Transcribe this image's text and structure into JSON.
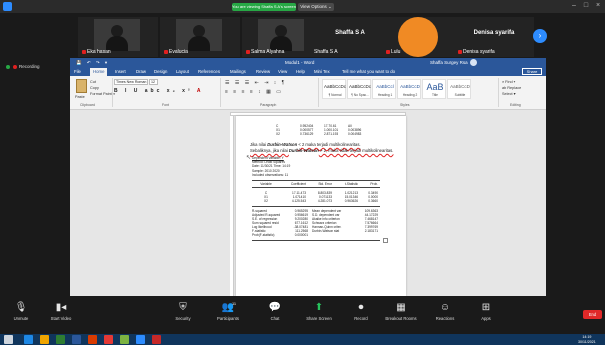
{
  "titlebar": {
    "share_banner": "You are viewing Shaffa S A's screen",
    "view_options": "View Options ⌄"
  },
  "participants": [
    {
      "name": "Eka hasan",
      "label": ""
    },
    {
      "name": "Evalucia",
      "label": ""
    },
    {
      "name": "Salma Alyahna",
      "label": ""
    },
    {
      "name": "Shaffa S A",
      "label": "Shaffa S A"
    },
    {
      "name": "Lulu",
      "label": ""
    },
    {
      "name": "Denisa syarifa",
      "label": "Denisa syarifa"
    }
  ],
  "recording": "Recording",
  "word": {
    "doc_title": "Modul1 - Word",
    "user": "Shaffa Surgey Rsa",
    "quick_access": "💾 ↶ ↷ ▾",
    "tabs": [
      "File",
      "Home",
      "Insert",
      "Draw",
      "Design",
      "Layout",
      "References",
      "Mailings",
      "Review",
      "View",
      "Help",
      "Mini Tex",
      "Tell me what you want to do"
    ],
    "share": "Share",
    "ribbon": {
      "paste": "Paste",
      "cut": "Cut",
      "copy": "Copy",
      "format_painter": "Format Painter",
      "clipboard": "Clipboard",
      "font_name": "Times New Roman",
      "font_size": "12",
      "format_buttons": "B I U abc x₂ x²",
      "font_color_a": "A",
      "font": "Font",
      "paragraph": "Paragraph",
      "styles": [
        {
          "sample": "AaBbCcDc",
          "name": "¶ Normal"
        },
        {
          "sample": "AaBbCcDc",
          "name": "¶ No Spac..."
        },
        {
          "sample": "AaBbCcl",
          "name": "Heading 1"
        },
        {
          "sample": "AaBbCcD",
          "name": "Heading 2"
        },
        {
          "sample": "AaB",
          "name": "Title"
        },
        {
          "sample": "AaBbCcD",
          "name": "Subtitle"
        }
      ],
      "styles_label": "Styles",
      "find": "⌕ Find ▾",
      "replace": "ab Replace",
      "select": "Select ▾",
      "editing": "Editing"
    }
  },
  "document": {
    "top_table": [
      [
        "C",
        "0.952404",
        "17.70.61",
        "All"
      ],
      [
        "X1",
        "0.000577",
        "1.000.101",
        "0.003896"
      ],
      [
        "X2",
        "0.736129",
        "2.871.193",
        "0.004983"
      ]
    ],
    "para_prefix": "Jika nilai ",
    "para_dw": "Durbin-Watson",
    "para_mid": " < 2 maka terjadi multikolinearitas.",
    "para_line2_prefix": "Sebaliknya, jika nilai ",
    "para_line2_suffix": " > 2, maka tidak terjadi multikolinearitas.",
    "regression_heading": "Dependent Variable: Y",
    "regression_lines": [
      "Method: Least Squares",
      "Date: 11/30/21   Time: 14:19",
      "Sample: 2010 2020",
      "Included observations: 11"
    ],
    "reg_header": [
      "Variable",
      "Coefficient",
      "Std. Error",
      "t-Statistic",
      "Prob."
    ],
    "reg_rows": [
      [
        "C",
        "17.11.473",
        "8.803.839",
        "1.021213",
        "0.3490"
      ],
      [
        "X1",
        "1.071410",
        "0.071133",
        "15.01346",
        "0.0000"
      ],
      [
        "X2",
        "4.125.543",
        "4.281.073",
        "0.963626",
        "0.3660"
      ]
    ],
    "stat_rows": [
      [
        "R-squared",
        "0.965295",
        "Mean dependent var",
        "109.6363"
      ],
      [
        "Adjusted R-squared",
        "0.956619",
        "S.D. dependent var",
        "44.17229"
      ],
      [
        "S.E. of regression",
        "9.200280",
        "Akaike info criterion",
        "7.468147"
      ],
      [
        "Sum squared resid",
        "677.1612",
        "Schwarz criterion",
        "7.576664"
      ],
      [
        "Log likelihood",
        "-38.07481",
        "Hannan-Quinn criter.",
        "7.399769"
      ],
      [
        "F-statistic",
        "111.2568",
        "Durbin-Watson stat",
        "2.183171"
      ],
      [
        "Prob(F-statistic)",
        "0.000001",
        "",
        ""
      ]
    ]
  },
  "toolbar": {
    "unmute": "Unmute",
    "start_video": "Start Video",
    "security": "Security",
    "participants": "Participants",
    "participants_count": "11",
    "chat": "Chat",
    "share_screen": "Share Screen",
    "record": "Record",
    "breakout_rooms": "Breakout Rooms",
    "reactions": "Reactions",
    "apps": "Apps",
    "end": "End"
  },
  "taskbar": {
    "time": "14:19",
    "date": "30/11/2021",
    "icon_colors": [
      "#1e88e5",
      "#f0a500",
      "#2e7d32",
      "#2b579a",
      "#d83b01",
      "#e53935",
      "#7cb342",
      "#2d8cff",
      "#c62828"
    ]
  }
}
